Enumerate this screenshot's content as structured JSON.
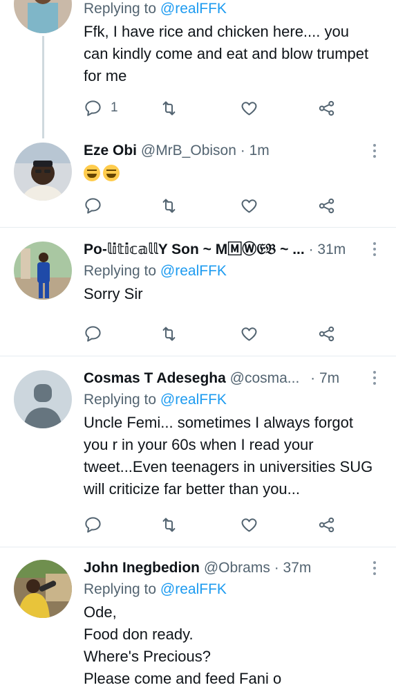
{
  "tweets": [
    {
      "replying_prefix": "Replying to",
      "replying_handle": "@realFFK",
      "text": "Ffk, I have rice and chicken here.... you can kindly come and eat and blow trumpet for me",
      "reply_count": "1"
    },
    {
      "name": "Eze Obi",
      "handle": "@MrB_Obison",
      "time": "· 1m",
      "emoji": "🤣🤣"
    },
    {
      "name": "Po-𝕝𝕚𝕥𝕚𝕔𝕒𝕝𝕝Y Son ~ M🄼Ⓦ𝔈𝔅 ~ ...",
      "time": "· 31m",
      "replying_prefix": "Replying to",
      "replying_handle": "@realFFK",
      "text": "Sorry Sir"
    },
    {
      "name": "Cosmas T Adesegha",
      "handle": "@cosma...",
      "time": "· 7m",
      "replying_prefix": "Replying to",
      "replying_handle": "@realFFK",
      "text": "Uncle Femi... sometimes I always forgot you r in your 60s when I read your tweet...Even teenagers in universities SUG will criticize far better than you..."
    },
    {
      "name": "John Inegbedion",
      "handle": "@Obrams",
      "time": "· 37m",
      "replying_prefix": "Replying to",
      "replying_handle": "@realFFK",
      "text_lines": [
        "Ode,",
        "Food don ready.",
        "Where's Precious?",
        "Please come and feed Fani o"
      ]
    }
  ],
  "icons": {
    "reply": "comment-icon",
    "retweet": "retweet-icon",
    "like": "heart-icon",
    "share": "share-icon",
    "more": "more-vertical-icon"
  },
  "colors": {
    "link": "#1d9bf0",
    "secondary_text": "#536471",
    "divider": "#e6ecf0"
  }
}
